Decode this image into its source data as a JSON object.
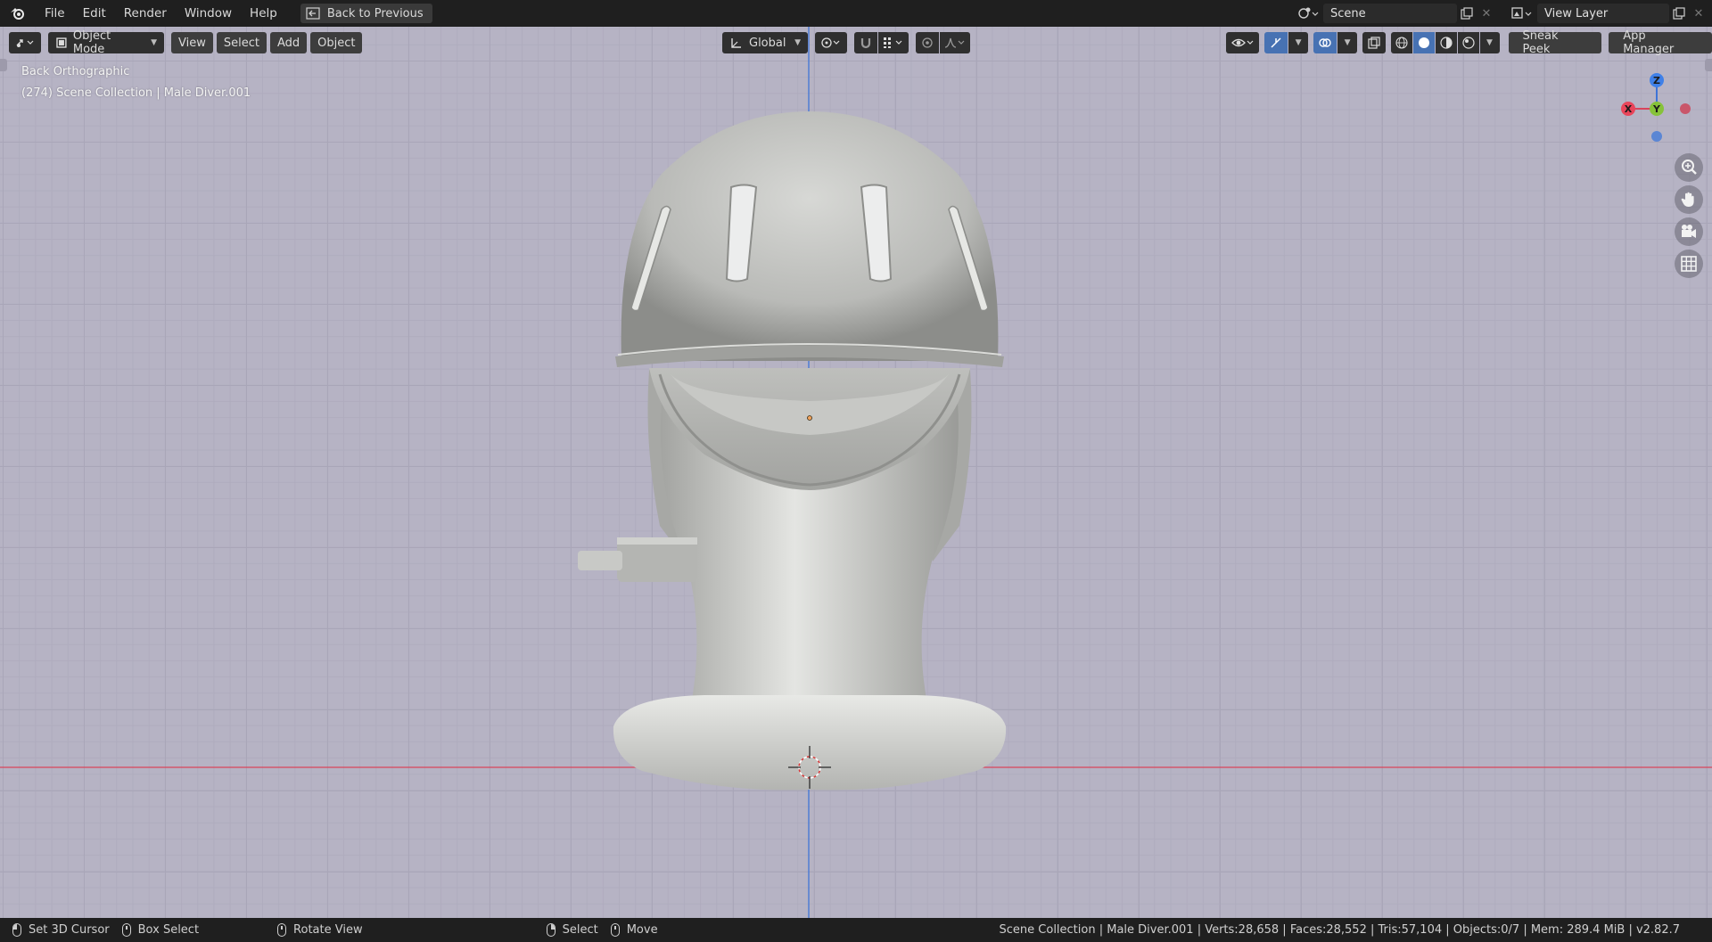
{
  "menu": {
    "items": [
      "File",
      "Edit",
      "Render",
      "Window",
      "Help"
    ],
    "back_button": "Back to Previous"
  },
  "top_right": {
    "scene": "Scene",
    "view_layer": "View Layer"
  },
  "viewport_header": {
    "mode": "Object Mode",
    "view": "View",
    "select": "Select",
    "add": "Add",
    "object": "Object",
    "transform_orientation": "Global",
    "sneak_peek": "Sneak Peek",
    "app_manager": "App Manager"
  },
  "viewport": {
    "view_name": "Back Orthographic",
    "collection_info": "(274) Scene Collection | Male Diver.001",
    "background_color": "#b6b3c4",
    "x_axis_color": "#d9445b",
    "z_axis_color": "#3f74d6"
  },
  "gizmo": {
    "z": "Z",
    "x": "X",
    "y": "Y"
  },
  "statusbar": {
    "set_cursor": "Set 3D Cursor",
    "box_select": "Box Select",
    "rotate_view": "Rotate View",
    "select": "Select",
    "move": "Move",
    "stats": "Scene Collection | Male Diver.001 | Verts:28,658 | Faces:28,552 | Tris:57,104 | Objects:0/7 | Mem: 289.4 MiB | v2.82.7"
  }
}
